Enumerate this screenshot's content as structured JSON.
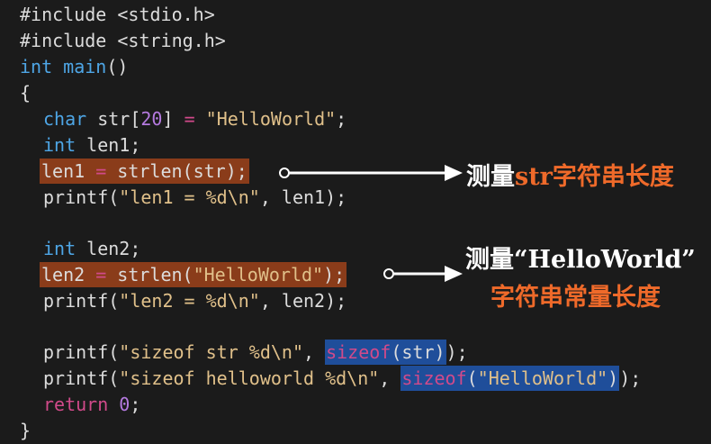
{
  "code": {
    "l1": "#include <stdio.h>",
    "l2": "#include <string.h>",
    "l3_type": "int",
    "l3_name": " main",
    "l3_rest": "()",
    "l4": "{",
    "l5_type": "char",
    "l5_a": " str[",
    "l5_num": "20",
    "l5_b": "] ",
    "l5_eq": "=",
    "l5_c": " ",
    "l5_str": "\"HelloWorld\"",
    "l5_d": ";",
    "l6_type": "int",
    "l6_rest": " len1;",
    "l7_a": "len1 ",
    "l7_eq": "=",
    "l7_b": " strlen(str);",
    "l8_a": "printf(",
    "l8_str": "\"len1 = %d\\n\"",
    "l8_b": ", len1);",
    "l9_type": "int",
    "l9_rest": " len2;",
    "l10_a": "len2 ",
    "l10_eq": "=",
    "l10_b": " strlen(",
    "l10_str": "\"HelloWorld\"",
    "l10_c": ");",
    "l11_a": "printf(",
    "l11_str": "\"len2 = %d\\n\"",
    "l11_b": ", len2);",
    "l12_a": "printf(",
    "l12_str": "\"sizeof str %d\\n\"",
    "l12_b": ", ",
    "l12_kw": "sizeof",
    "l12_c": "(str)",
    "l12_d": ");",
    "l13_a": "printf(",
    "l13_str": "\"sizeof helloworld %d\\n\"",
    "l13_b": ", ",
    "l13_kw": "sizeof",
    "l13_c": "(",
    "l13_str2": "\"HelloWorld\"",
    "l13_d": ")",
    "l13_e": ");",
    "l14_kw": "return",
    "l14_b": " ",
    "l14_num": "0",
    "l14_c": ";",
    "l15": "}"
  },
  "annotations": {
    "a1_white": "测量",
    "a1_orange": "str字符串长度",
    "a2_white": "测量“HelloWorld”",
    "a2_orange": "字符串常量长度"
  },
  "colors": {
    "background": "#1b1b1b",
    "highlight_orange": "#8a3c1a",
    "highlight_blue": "#1f4e9a",
    "keyword_blue": "#4ea6e6",
    "number_purple": "#b57ae0",
    "string_tan": "#e0c08a",
    "keyword_pink": "#d14a8a",
    "annotation_orange": "#ef6a2a"
  }
}
